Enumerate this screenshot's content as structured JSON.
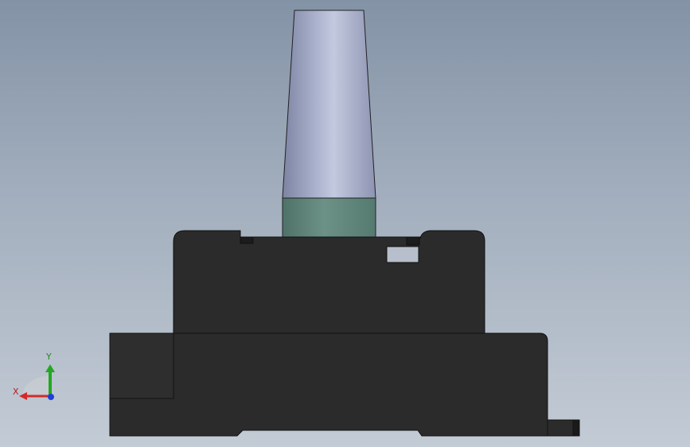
{
  "viewport": {
    "background_top": "#8393a6",
    "background_bottom": "#c3cbd5"
  },
  "model": {
    "probe_color": "#a9afc8",
    "collar_color": "#62877d",
    "housing_color": "#2b2b2b",
    "edge_color": "#111111"
  },
  "triad": {
    "x_label": "X",
    "y_label": "Y",
    "x_color": "#d42a2a",
    "y_color": "#22a822",
    "z_color": "#1f3fd8"
  }
}
